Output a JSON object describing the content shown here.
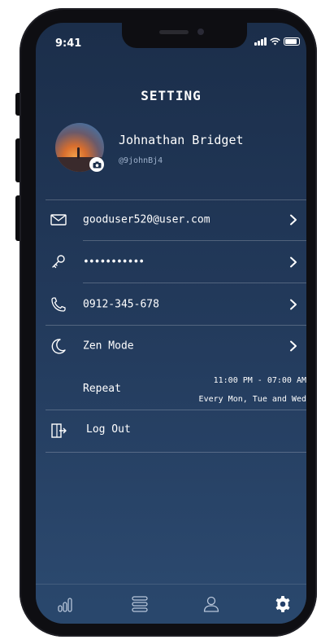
{
  "status_bar": {
    "time": "9:41"
  },
  "header": {
    "title": "SETTING"
  },
  "profile": {
    "name": "Johnathan Bridget",
    "handle": "@9johnBj4"
  },
  "settings": {
    "email": "gooduser520@user.com",
    "password": "•••••••••••",
    "phone": "0912-345-678",
    "zen_mode": "Zen Mode",
    "repeat_label": "Repeat",
    "repeat_time": "11:00 PM - 07:00 AM",
    "repeat_days": "Every Mon, Tue and Wed",
    "logout": "Log Out"
  },
  "tabs": [
    "stats-icon",
    "menu-icon",
    "profile-icon",
    "settings-icon"
  ],
  "colors": {
    "screen_top": "#1b2e4a",
    "screen_bottom": "#2c4a70",
    "text": "#ffffff",
    "muted": "#9fb2cc"
  }
}
